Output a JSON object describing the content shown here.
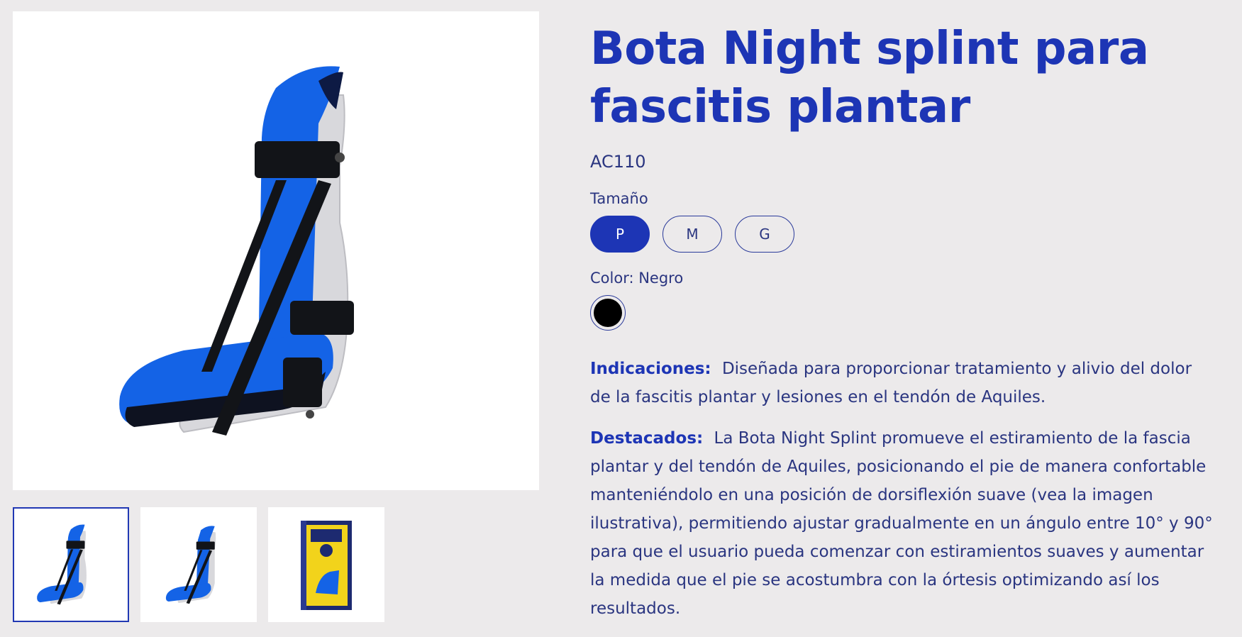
{
  "product": {
    "title": "Bota Night splint para fascitis plantar",
    "sku": "AC110"
  },
  "size": {
    "label": "Tamaño",
    "options": [
      "P",
      "M",
      "G"
    ],
    "selected": "P"
  },
  "color": {
    "label": "Color: Negro",
    "swatch_hex": "#000000"
  },
  "indicaciones": {
    "label": "Indicaciones:",
    "text": "Diseñada para proporcionar tratamiento y alivio del dolor de la fascitis plantar y lesiones en el tendón de Aquiles."
  },
  "destacados": {
    "label": "Destacados:",
    "text": "La Bota Night Splint promueve el estiramiento de la fascia plantar y del tendón de Aquiles, posicionando el pie de manera confortable manteniéndolo en una posición de dorsiflexión suave (vea la imagen ilustrativa), permitiendo ajustar gradualmente en un ángulo entre 10° y 90° para que el usuario pueda comenzar con estiramientos suaves y aumentar la medida que el pie se acostumbra con la órtesis optimizando así los resultados."
  },
  "gallery": {
    "thumbnails": [
      "night-splint-side-view",
      "night-splint-angle-view",
      "night-splint-box"
    ],
    "selected_index": 0
  },
  "colors": {
    "accent": "#1d35b5",
    "text": "#2a3580",
    "background": "#eceaeb",
    "product_blue": "#1560e0"
  }
}
